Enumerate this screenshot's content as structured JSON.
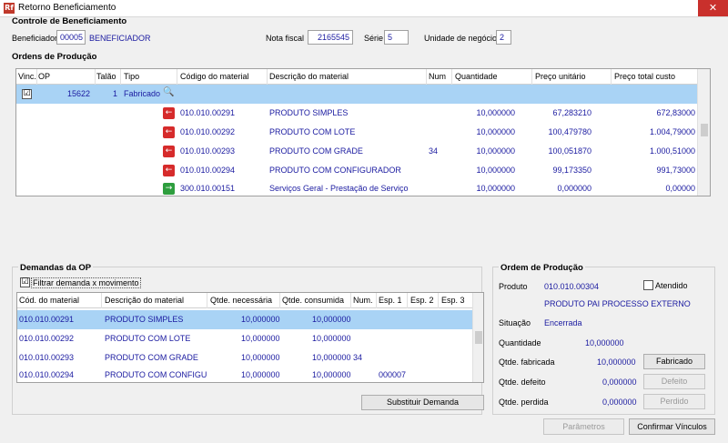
{
  "window": {
    "title": "Retorno Beneficiamento",
    "app_icon_text": "Rf",
    "close_glyph": "✕"
  },
  "controle": {
    "section_title": "Controle de Beneficiamento",
    "beneficiador_label": "Beneficiador",
    "beneficiador_code": "00005",
    "beneficiador_name": "BENEFICIADOR",
    "nota_label": "Nota fiscal",
    "nota_value": "2165545",
    "serie_label": "Série",
    "serie_value": "5",
    "unidade_label": "Unidade de negócio",
    "unidade_value": "2"
  },
  "ordens": {
    "section_title": "Ordens de Produção",
    "columns": [
      "Vinc.",
      "OP",
      "Talão",
      "Tipo",
      "Código do material",
      "Descrição do material",
      "Num",
      "Quantidade",
      "Preço unitário",
      "Preço total custo"
    ],
    "op_row": {
      "vinc": "☑",
      "op": "15622",
      "talao": "1",
      "tipo": "Fabricado",
      "search_glyph": "🔍"
    },
    "materials": [
      {
        "dir": "←",
        "codigo": "010.010.00291",
        "descricao": "PRODUTO SIMPLES",
        "num": "",
        "quantidade": "10,000000",
        "preco_unit": "67,283210",
        "preco_total": "672,83000"
      },
      {
        "dir": "←",
        "codigo": "010.010.00292",
        "descricao": "PRODUTO COM LOTE",
        "num": "",
        "quantidade": "10,000000",
        "preco_unit": "100,479780",
        "preco_total": "1.004,79000"
      },
      {
        "dir": "←",
        "codigo": "010.010.00293",
        "descricao": "PRODUTO COM GRADE",
        "num": "34",
        "quantidade": "10,000000",
        "preco_unit": "100,051870",
        "preco_total": "1.000,51000"
      },
      {
        "dir": "←",
        "codigo": "010.010.00294",
        "descricao": "PRODUTO COM CONFIGURADOR",
        "num": "",
        "quantidade": "10,000000",
        "preco_unit": "99,173350",
        "preco_total": "991,73000"
      },
      {
        "dir": "→",
        "codigo": "300.010.00151",
        "descricao": "Serviços Geral - Prestação de Serviço",
        "num": "",
        "quantidade": "10,000000",
        "preco_unit": "0,000000",
        "preco_total": "0,00000"
      }
    ]
  },
  "demandas": {
    "section_title": "Demandas da OP",
    "filter_checkbox_label": "Filtrar demanda x movimento",
    "filter_checked": "☑",
    "columns": [
      "Cód. do material",
      "Descrição do material",
      "Qtde. necessária",
      "Qtde. consumida",
      "Num.",
      "Esp. 1",
      "Esp. 2",
      "Esp. 3"
    ],
    "rows": [
      {
        "codigo": "010.010.00291",
        "descricao": "PRODUTO SIMPLES",
        "necessaria": "10,000000",
        "consumida": "10,000000",
        "num": "",
        "esp1": ""
      },
      {
        "codigo": "010.010.00292",
        "descricao": "PRODUTO COM LOTE",
        "necessaria": "10,000000",
        "consumida": "10,000000",
        "num": "",
        "esp1": ""
      },
      {
        "codigo": "010.010.00293",
        "descricao": "PRODUTO COM GRADE",
        "necessaria": "10,000000",
        "consumida": "10,000000",
        "num": "34",
        "esp1": ""
      },
      {
        "codigo": "010.010.00294",
        "descricao": "PRODUTO COM CONFIGURAD",
        "necessaria": "10,000000",
        "consumida": "10,000000",
        "num": "",
        "esp1": "000007"
      }
    ],
    "substituir_button": "Substituir Demanda"
  },
  "ordem_producao": {
    "section_title": "Ordem de Produção",
    "produto_label": "Produto",
    "produto_code": "010.010.00304",
    "atendido_label": "Atendido",
    "produto_name": "PRODUTO PAI PROCESSO EXTERNO",
    "situacao_label": "Situação",
    "situacao_value": "Encerrada",
    "quantidade_label": "Quantidade",
    "quantidade_value": "10,000000",
    "fabricada_label": "Qtde. fabricada",
    "fabricada_value": "10,000000",
    "fabricado_button": "Fabricado",
    "defeito_label": "Qtde. defeito",
    "defeito_value": "0,000000",
    "defeito_button": "Defeito",
    "perdida_label": "Qtde. perdida",
    "perdida_value": "0,000000",
    "perdido_button": "Perdido"
  },
  "footer": {
    "parametros_button": "Parâmetros",
    "confirmar_button": "Confirmar Vínculos"
  },
  "colors": {
    "selection": "#a9d3f5",
    "value_text": "#1a1aa0",
    "close_red": "#c9302c"
  }
}
